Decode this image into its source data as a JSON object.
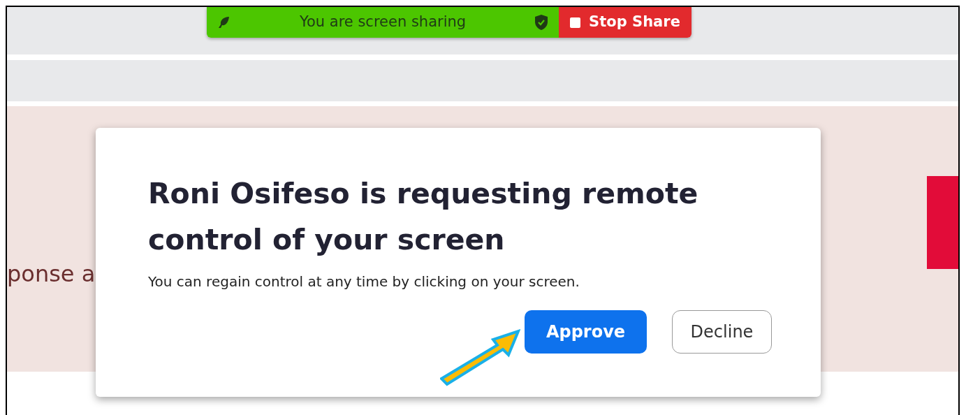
{
  "share_bar": {
    "status": "You are screen sharing",
    "stop_button": "Stop Share"
  },
  "background": {
    "partial_text": "ponse a"
  },
  "dialog": {
    "title": "Roni Osifeso is requesting remote control of your screen",
    "message": "You can regain control at any time by clicking on your screen.",
    "buttons": [
      {
        "label": "Approve",
        "kind": "primary"
      },
      {
        "label": "Decline",
        "kind": "secondary"
      }
    ]
  }
}
